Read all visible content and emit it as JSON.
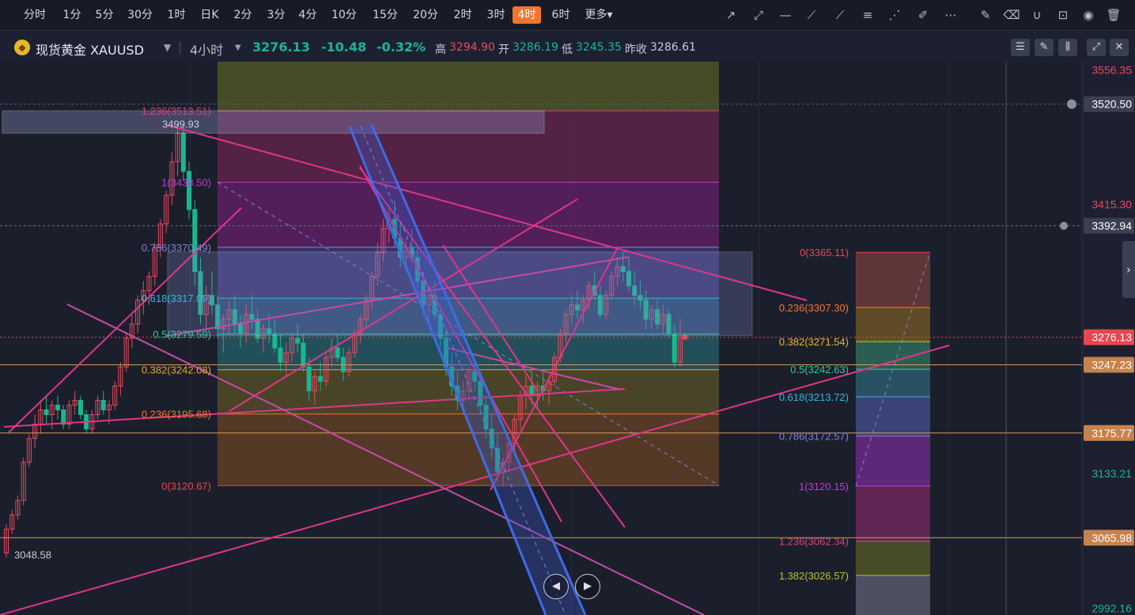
{
  "timeframes": [
    "分时",
    "1分",
    "5分",
    "30分",
    "1时",
    "日K",
    "2分",
    "3分",
    "4分",
    "10分",
    "15分",
    "20分",
    "2时",
    "3时",
    "4时",
    "6时",
    "更多▾"
  ],
  "active_timeframe": "4时",
  "toolbar_icons": [
    "trend-line-icon",
    "ray-icon",
    "horizontal-line-icon",
    "polyline-icon",
    "segment-icon",
    "fib-retracement-icon",
    "fib-fan-icon",
    "brush-icon",
    "more-dots-icon",
    "edit-icon",
    "eraser-icon",
    "magnet-icon",
    "lock-icon",
    "eye-icon",
    "trash-icon"
  ],
  "symbol": {
    "name": "现货黄金 XAUUSD",
    "period": "4小时",
    "price": "3276.13",
    "change": "-10.48",
    "change_pct": "-0.32%",
    "high_label": "高",
    "high": "3294.90",
    "open_label": "开",
    "open": "3286.19",
    "low_label": "低",
    "low": "3245.35",
    "prev_label": "昨收",
    "prev": "3286.61"
  },
  "colors": {
    "down": "#17b890",
    "up": "#e84a5f",
    "accent": "#f2762f",
    "bg": "#1c2030"
  },
  "nav_buttons": [
    "◀",
    "▶"
  ],
  "chart_data": {
    "type": "candlestick",
    "instrument": "XAUUSD",
    "timeframe": "4小时",
    "ylim": [
      2985,
      3565
    ],
    "y_price_labels": [
      {
        "value": 3556.35,
        "text": "3556.35",
        "color": "#e84a5f"
      },
      {
        "value": 3520.5,
        "text": "3520.50",
        "color": "#ffffff",
        "boxed": true,
        "bg": "#3b4050"
      },
      {
        "value": 3415.3,
        "text": "3415.30",
        "color": "#e84a5f"
      },
      {
        "value": 3392.94,
        "text": "3392.94",
        "color": "#ffffff",
        "boxed": true,
        "bg": "#3b4050"
      },
      {
        "value": 3276.13,
        "text": "3276.13",
        "color": "#ffffff",
        "boxed": true,
        "bg": "#e8474f"
      },
      {
        "value": 3247.23,
        "text": "3247.23",
        "color": "#ffffff",
        "boxed": true,
        "bg": "#c7834d"
      },
      {
        "value": 3175.77,
        "text": "3175.77",
        "color": "#ffffff",
        "boxed": true,
        "bg": "#c7834d"
      },
      {
        "value": 3133.21,
        "text": "3133.21",
        "color": "#17b890"
      },
      {
        "value": 3065.98,
        "text": "3065.98",
        "color": "#ffffff",
        "boxed": true,
        "bg": "#c7834d"
      },
      {
        "value": 2992.16,
        "text": "2992.16",
        "color": "#17b890"
      }
    ],
    "annotations": [
      {
        "text": "3499.93",
        "value": 3499.93
      },
      {
        "text": "3048.58",
        "value": 3048.58
      }
    ],
    "fib_left": {
      "low": 3120.67,
      "high": 3438.5,
      "levels": [
        {
          "text": "1.236(3513.51)",
          "value": 3513.51,
          "color": "#d8437e"
        },
        {
          "text": "1(3438.50)",
          "value": 3438.5,
          "color": "#c43bd0"
        },
        {
          "text": "0.786(3370.49)",
          "value": 3370.49,
          "color": "#7d86d4"
        },
        {
          "text": "0.618(3317.09)",
          "value": 3317.09,
          "color": "#35b7dc"
        },
        {
          "text": "0.5(3279.59)",
          "value": 3279.59,
          "color": "#35c7a5"
        },
        {
          "text": "0.382(3242.08)",
          "value": 3242.08,
          "color": "#e6a82d"
        },
        {
          "text": "0.236(3195.68)",
          "value": 3195.68,
          "color": "#f0762f"
        },
        {
          "text": "0(3120.67)",
          "value": 3120.67,
          "color": "#e8474f"
        }
      ]
    },
    "fib_right": {
      "levels": [
        {
          "text": "0(3365.11)",
          "value": 3365.11,
          "color": "#e8474f"
        },
        {
          "text": "0.236(3307.30)",
          "value": 3307.3,
          "color": "#f0762f"
        },
        {
          "text": "0.382(3271.54)",
          "value": 3271.54,
          "color": "#e6b82d"
        },
        {
          "text": "0.5(3242.63)",
          "value": 3242.63,
          "color": "#35c7a5"
        },
        {
          "text": "0.618(3213.72)",
          "value": 3213.72,
          "color": "#35b7dc"
        },
        {
          "text": "0.786(3172.57)",
          "value": 3172.57,
          "color": "#7d86d4"
        },
        {
          "text": "1(3120.15)",
          "value": 3120.15,
          "color": "#c43bd0"
        },
        {
          "text": "1.236(3062.34)",
          "value": 3062.34,
          "color": "#d8437e"
        },
        {
          "text": "1.382(3026.57)",
          "value": 3026.57,
          "color": "#b9c237"
        }
      ]
    },
    "candles": [
      [
        3050,
        3080,
        3045,
        3075
      ],
      [
        3075,
        3095,
        3070,
        3090
      ],
      [
        3090,
        3110,
        3085,
        3105
      ],
      [
        3105,
        3150,
        3100,
        3145
      ],
      [
        3145,
        3175,
        3140,
        3170
      ],
      [
        3170,
        3195,
        3160,
        3185
      ],
      [
        3185,
        3210,
        3175,
        3200
      ],
      [
        3200,
        3215,
        3185,
        3195
      ],
      [
        3195,
        3210,
        3180,
        3205
      ],
      [
        3205,
        3215,
        3190,
        3200
      ],
      [
        3200,
        3205,
        3180,
        3185
      ],
      [
        3185,
        3210,
        3180,
        3205
      ],
      [
        3205,
        3220,
        3195,
        3210
      ],
      [
        3210,
        3215,
        3190,
        3195
      ],
      [
        3195,
        3200,
        3175,
        3180
      ],
      [
        3180,
        3200,
        3175,
        3195
      ],
      [
        3195,
        3215,
        3190,
        3210
      ],
      [
        3210,
        3220,
        3195,
        3200
      ],
      [
        3200,
        3210,
        3185,
        3205
      ],
      [
        3205,
        3230,
        3200,
        3225
      ],
      [
        3225,
        3250,
        3215,
        3245
      ],
      [
        3245,
        3280,
        3240,
        3275
      ],
      [
        3275,
        3300,
        3265,
        3290
      ],
      [
        3290,
        3320,
        3280,
        3315
      ],
      [
        3315,
        3335,
        3300,
        3325
      ],
      [
        3325,
        3345,
        3310,
        3340
      ],
      [
        3340,
        3375,
        3330,
        3370
      ],
      [
        3370,
        3400,
        3360,
        3395
      ],
      [
        3395,
        3430,
        3385,
        3425
      ],
      [
        3425,
        3470,
        3415,
        3460
      ],
      [
        3460,
        3500,
        3445,
        3490
      ],
      [
        3490,
        3499.93,
        3440,
        3450
      ],
      [
        3450,
        3460,
        3400,
        3410
      ],
      [
        3410,
        3420,
        3330,
        3345
      ],
      [
        3345,
        3360,
        3290,
        3300
      ],
      [
        3300,
        3330,
        3285,
        3320
      ],
      [
        3320,
        3345,
        3300,
        3310
      ],
      [
        3310,
        3320,
        3275,
        3285
      ],
      [
        3285,
        3300,
        3260,
        3295
      ],
      [
        3295,
        3315,
        3280,
        3305
      ],
      [
        3305,
        3320,
        3280,
        3290
      ],
      [
        3290,
        3300,
        3265,
        3280
      ],
      [
        3280,
        3310,
        3270,
        3300
      ],
      [
        3300,
        3320,
        3285,
        3295
      ],
      [
        3295,
        3305,
        3270,
        3275
      ],
      [
        3275,
        3290,
        3260,
        3285
      ],
      [
        3285,
        3300,
        3270,
        3280
      ],
      [
        3280,
        3295,
        3260,
        3265
      ],
      [
        3265,
        3280,
        3240,
        3250
      ],
      [
        3250,
        3270,
        3235,
        3260
      ],
      [
        3260,
        3280,
        3250,
        3275
      ],
      [
        3275,
        3290,
        3260,
        3270
      ],
      [
        3270,
        3280,
        3240,
        3245
      ],
      [
        3245,
        3255,
        3210,
        3220
      ],
      [
        3220,
        3240,
        3205,
        3235
      ],
      [
        3235,
        3250,
        3220,
        3230
      ],
      [
        3230,
        3260,
        3225,
        3255
      ],
      [
        3255,
        3275,
        3245,
        3265
      ],
      [
        3265,
        3280,
        3250,
        3255
      ],
      [
        3255,
        3265,
        3230,
        3240
      ],
      [
        3240,
        3265,
        3235,
        3260
      ],
      [
        3260,
        3285,
        3255,
        3280
      ],
      [
        3280,
        3300,
        3270,
        3295
      ],
      [
        3295,
        3320,
        3285,
        3315
      ],
      [
        3315,
        3345,
        3305,
        3340
      ],
      [
        3340,
        3375,
        3330,
        3365
      ],
      [
        3365,
        3400,
        3355,
        3390
      ],
      [
        3390,
        3415,
        3375,
        3400
      ],
      [
        3400,
        3420,
        3370,
        3380
      ],
      [
        3380,
        3395,
        3350,
        3360
      ],
      [
        3360,
        3380,
        3345,
        3370
      ],
      [
        3370,
        3390,
        3355,
        3360
      ],
      [
        3360,
        3370,
        3325,
        3335
      ],
      [
        3335,
        3345,
        3300,
        3310
      ],
      [
        3310,
        3330,
        3290,
        3320
      ],
      [
        3320,
        3335,
        3295,
        3300
      ],
      [
        3300,
        3310,
        3265,
        3275
      ],
      [
        3275,
        3285,
        3235,
        3245
      ],
      [
        3245,
        3260,
        3215,
        3225
      ],
      [
        3225,
        3240,
        3200,
        3210
      ],
      [
        3210,
        3230,
        3195,
        3220
      ],
      [
        3220,
        3245,
        3210,
        3240
      ],
      [
        3240,
        3255,
        3220,
        3230
      ],
      [
        3230,
        3240,
        3195,
        3205
      ],
      [
        3205,
        3215,
        3170,
        3180
      ],
      [
        3180,
        3195,
        3150,
        3160
      ],
      [
        3160,
        3175,
        3125,
        3135
      ],
      [
        3135,
        3150,
        3120,
        3145
      ],
      [
        3145,
        3170,
        3135,
        3165
      ],
      [
        3165,
        3195,
        3155,
        3190
      ],
      [
        3190,
        3220,
        3180,
        3215
      ],
      [
        3215,
        3235,
        3200,
        3225
      ],
      [
        3225,
        3240,
        3205,
        3215
      ],
      [
        3215,
        3230,
        3200,
        3225
      ],
      [
        3225,
        3240,
        3210,
        3220
      ],
      [
        3220,
        3235,
        3205,
        3230
      ],
      [
        3230,
        3260,
        3225,
        3255
      ],
      [
        3255,
        3285,
        3250,
        3280
      ],
      [
        3280,
        3305,
        3270,
        3300
      ],
      [
        3300,
        3320,
        3290,
        3310
      ],
      [
        3310,
        3325,
        3295,
        3305
      ],
      [
        3305,
        3320,
        3290,
        3315
      ],
      [
        3315,
        3335,
        3305,
        3330
      ],
      [
        3330,
        3345,
        3315,
        3320
      ],
      [
        3320,
        3330,
        3295,
        3300
      ],
      [
        3300,
        3325,
        3295,
        3320
      ],
      [
        3320,
        3345,
        3315,
        3340
      ],
      [
        3340,
        3360,
        3330,
        3350
      ],
      [
        3350,
        3365,
        3335,
        3345
      ],
      [
        3345,
        3360,
        3325,
        3330
      ],
      [
        3330,
        3345,
        3310,
        3320
      ],
      [
        3320,
        3335,
        3305,
        3315
      ],
      [
        3315,
        3325,
        3285,
        3295
      ],
      [
        3295,
        3310,
        3285,
        3305
      ],
      [
        3305,
        3315,
        3285,
        3290
      ],
      [
        3290,
        3310,
        3280,
        3300
      ],
      [
        3300,
        3305,
        3275,
        3280
      ],
      [
        3280,
        3290,
        3245,
        3250
      ],
      [
        3250,
        3294.9,
        3245.35,
        3276.13
      ]
    ]
  }
}
